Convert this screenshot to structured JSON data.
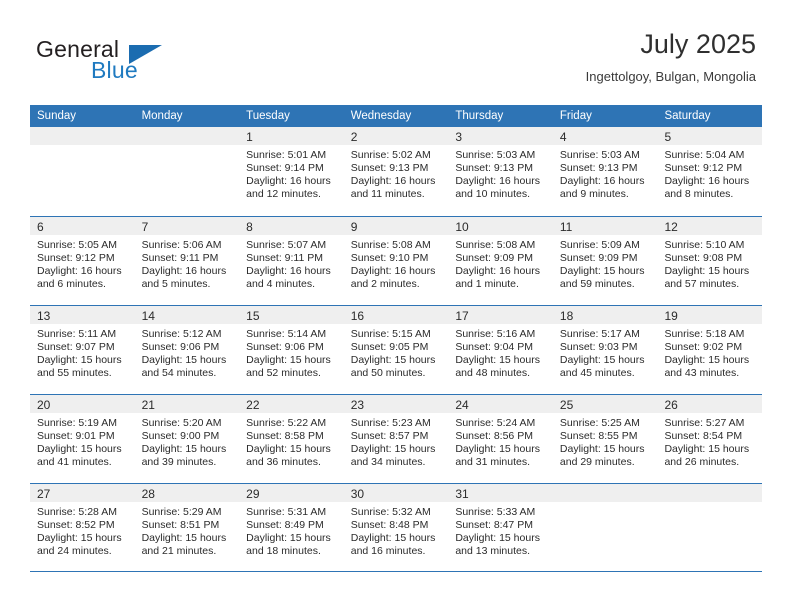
{
  "brand": {
    "name_part1": "General",
    "name_part2": "Blue",
    "accent_color": "#1b6cb0"
  },
  "header": {
    "title": "July 2025",
    "subtitle": "Ingettolgoy, Bulgan, Mongolia"
  },
  "theme": {
    "header_blue": "#2e74b5",
    "daynum_band": "#efefef",
    "text": "#2b2b2b"
  },
  "calendar": {
    "weekday_headers": [
      "Sunday",
      "Monday",
      "Tuesday",
      "Wednesday",
      "Thursday",
      "Friday",
      "Saturday"
    ],
    "weeks": [
      [
        {
          "day": "",
          "empty": true,
          "sunrise": "",
          "sunset": "",
          "daylight_line1": "",
          "daylight_line2": ""
        },
        {
          "day": "",
          "empty": true,
          "sunrise": "",
          "sunset": "",
          "daylight_line1": "",
          "daylight_line2": ""
        },
        {
          "day": "1",
          "empty": false,
          "sunrise": "Sunrise: 5:01 AM",
          "sunset": "Sunset: 9:14 PM",
          "daylight_line1": "Daylight: 16 hours",
          "daylight_line2": "and 12 minutes."
        },
        {
          "day": "2",
          "empty": false,
          "sunrise": "Sunrise: 5:02 AM",
          "sunset": "Sunset: 9:13 PM",
          "daylight_line1": "Daylight: 16 hours",
          "daylight_line2": "and 11 minutes."
        },
        {
          "day": "3",
          "empty": false,
          "sunrise": "Sunrise: 5:03 AM",
          "sunset": "Sunset: 9:13 PM",
          "daylight_line1": "Daylight: 16 hours",
          "daylight_line2": "and 10 minutes."
        },
        {
          "day": "4",
          "empty": false,
          "sunrise": "Sunrise: 5:03 AM",
          "sunset": "Sunset: 9:13 PM",
          "daylight_line1": "Daylight: 16 hours",
          "daylight_line2": "and 9 minutes."
        },
        {
          "day": "5",
          "empty": false,
          "sunrise": "Sunrise: 5:04 AM",
          "sunset": "Sunset: 9:12 PM",
          "daylight_line1": "Daylight: 16 hours",
          "daylight_line2": "and 8 minutes."
        }
      ],
      [
        {
          "day": "6",
          "empty": false,
          "sunrise": "Sunrise: 5:05 AM",
          "sunset": "Sunset: 9:12 PM",
          "daylight_line1": "Daylight: 16 hours",
          "daylight_line2": "and 6 minutes."
        },
        {
          "day": "7",
          "empty": false,
          "sunrise": "Sunrise: 5:06 AM",
          "sunset": "Sunset: 9:11 PM",
          "daylight_line1": "Daylight: 16 hours",
          "daylight_line2": "and 5 minutes."
        },
        {
          "day": "8",
          "empty": false,
          "sunrise": "Sunrise: 5:07 AM",
          "sunset": "Sunset: 9:11 PM",
          "daylight_line1": "Daylight: 16 hours",
          "daylight_line2": "and 4 minutes."
        },
        {
          "day": "9",
          "empty": false,
          "sunrise": "Sunrise: 5:08 AM",
          "sunset": "Sunset: 9:10 PM",
          "daylight_line1": "Daylight: 16 hours",
          "daylight_line2": "and 2 minutes."
        },
        {
          "day": "10",
          "empty": false,
          "sunrise": "Sunrise: 5:08 AM",
          "sunset": "Sunset: 9:09 PM",
          "daylight_line1": "Daylight: 16 hours",
          "daylight_line2": "and 1 minute."
        },
        {
          "day": "11",
          "empty": false,
          "sunrise": "Sunrise: 5:09 AM",
          "sunset": "Sunset: 9:09 PM",
          "daylight_line1": "Daylight: 15 hours",
          "daylight_line2": "and 59 minutes."
        },
        {
          "day": "12",
          "empty": false,
          "sunrise": "Sunrise: 5:10 AM",
          "sunset": "Sunset: 9:08 PM",
          "daylight_line1": "Daylight: 15 hours",
          "daylight_line2": "and 57 minutes."
        }
      ],
      [
        {
          "day": "13",
          "empty": false,
          "sunrise": "Sunrise: 5:11 AM",
          "sunset": "Sunset: 9:07 PM",
          "daylight_line1": "Daylight: 15 hours",
          "daylight_line2": "and 55 minutes."
        },
        {
          "day": "14",
          "empty": false,
          "sunrise": "Sunrise: 5:12 AM",
          "sunset": "Sunset: 9:06 PM",
          "daylight_line1": "Daylight: 15 hours",
          "daylight_line2": "and 54 minutes."
        },
        {
          "day": "15",
          "empty": false,
          "sunrise": "Sunrise: 5:14 AM",
          "sunset": "Sunset: 9:06 PM",
          "daylight_line1": "Daylight: 15 hours",
          "daylight_line2": "and 52 minutes."
        },
        {
          "day": "16",
          "empty": false,
          "sunrise": "Sunrise: 5:15 AM",
          "sunset": "Sunset: 9:05 PM",
          "daylight_line1": "Daylight: 15 hours",
          "daylight_line2": "and 50 minutes."
        },
        {
          "day": "17",
          "empty": false,
          "sunrise": "Sunrise: 5:16 AM",
          "sunset": "Sunset: 9:04 PM",
          "daylight_line1": "Daylight: 15 hours",
          "daylight_line2": "and 48 minutes."
        },
        {
          "day": "18",
          "empty": false,
          "sunrise": "Sunrise: 5:17 AM",
          "sunset": "Sunset: 9:03 PM",
          "daylight_line1": "Daylight: 15 hours",
          "daylight_line2": "and 45 minutes."
        },
        {
          "day": "19",
          "empty": false,
          "sunrise": "Sunrise: 5:18 AM",
          "sunset": "Sunset: 9:02 PM",
          "daylight_line1": "Daylight: 15 hours",
          "daylight_line2": "and 43 minutes."
        }
      ],
      [
        {
          "day": "20",
          "empty": false,
          "sunrise": "Sunrise: 5:19 AM",
          "sunset": "Sunset: 9:01 PM",
          "daylight_line1": "Daylight: 15 hours",
          "daylight_line2": "and 41 minutes."
        },
        {
          "day": "21",
          "empty": false,
          "sunrise": "Sunrise: 5:20 AM",
          "sunset": "Sunset: 9:00 PM",
          "daylight_line1": "Daylight: 15 hours",
          "daylight_line2": "and 39 minutes."
        },
        {
          "day": "22",
          "empty": false,
          "sunrise": "Sunrise: 5:22 AM",
          "sunset": "Sunset: 8:58 PM",
          "daylight_line1": "Daylight: 15 hours",
          "daylight_line2": "and 36 minutes."
        },
        {
          "day": "23",
          "empty": false,
          "sunrise": "Sunrise: 5:23 AM",
          "sunset": "Sunset: 8:57 PM",
          "daylight_line1": "Daylight: 15 hours",
          "daylight_line2": "and 34 minutes."
        },
        {
          "day": "24",
          "empty": false,
          "sunrise": "Sunrise: 5:24 AM",
          "sunset": "Sunset: 8:56 PM",
          "daylight_line1": "Daylight: 15 hours",
          "daylight_line2": "and 31 minutes."
        },
        {
          "day": "25",
          "empty": false,
          "sunrise": "Sunrise: 5:25 AM",
          "sunset": "Sunset: 8:55 PM",
          "daylight_line1": "Daylight: 15 hours",
          "daylight_line2": "and 29 minutes."
        },
        {
          "day": "26",
          "empty": false,
          "sunrise": "Sunrise: 5:27 AM",
          "sunset": "Sunset: 8:54 PM",
          "daylight_line1": "Daylight: 15 hours",
          "daylight_line2": "and 26 minutes."
        }
      ],
      [
        {
          "day": "27",
          "empty": false,
          "sunrise": "Sunrise: 5:28 AM",
          "sunset": "Sunset: 8:52 PM",
          "daylight_line1": "Daylight: 15 hours",
          "daylight_line2": "and 24 minutes."
        },
        {
          "day": "28",
          "empty": false,
          "sunrise": "Sunrise: 5:29 AM",
          "sunset": "Sunset: 8:51 PM",
          "daylight_line1": "Daylight: 15 hours",
          "daylight_line2": "and 21 minutes."
        },
        {
          "day": "29",
          "empty": false,
          "sunrise": "Sunrise: 5:31 AM",
          "sunset": "Sunset: 8:49 PM",
          "daylight_line1": "Daylight: 15 hours",
          "daylight_line2": "and 18 minutes."
        },
        {
          "day": "30",
          "empty": false,
          "sunrise": "Sunrise: 5:32 AM",
          "sunset": "Sunset: 8:48 PM",
          "daylight_line1": "Daylight: 15 hours",
          "daylight_line2": "and 16 minutes."
        },
        {
          "day": "31",
          "empty": false,
          "sunrise": "Sunrise: 5:33 AM",
          "sunset": "Sunset: 8:47 PM",
          "daylight_line1": "Daylight: 15 hours",
          "daylight_line2": "and 13 minutes."
        },
        {
          "day": "",
          "empty": true,
          "sunrise": "",
          "sunset": "",
          "daylight_line1": "",
          "daylight_line2": ""
        },
        {
          "day": "",
          "empty": true,
          "sunrise": "",
          "sunset": "",
          "daylight_line1": "",
          "daylight_line2": ""
        }
      ]
    ]
  }
}
